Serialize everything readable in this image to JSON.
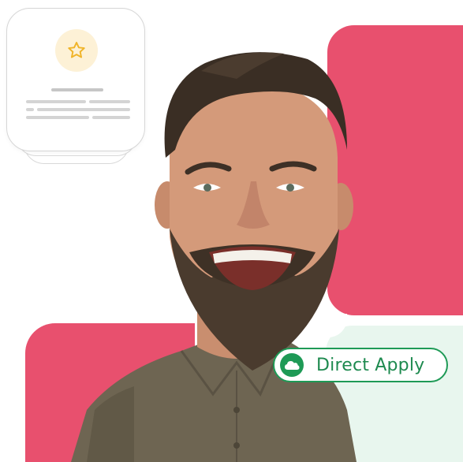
{
  "badge": {
    "label": "Direct Apply",
    "icon": "cloud-icon",
    "color": "#1E9A56"
  },
  "card": {
    "icon": "star-icon",
    "icon_color": "#F0B429",
    "badge_bg": "#FDF1D6"
  },
  "colors": {
    "accent_pink": "#E8506E",
    "accent_green_bg": "#E8F6EE"
  }
}
